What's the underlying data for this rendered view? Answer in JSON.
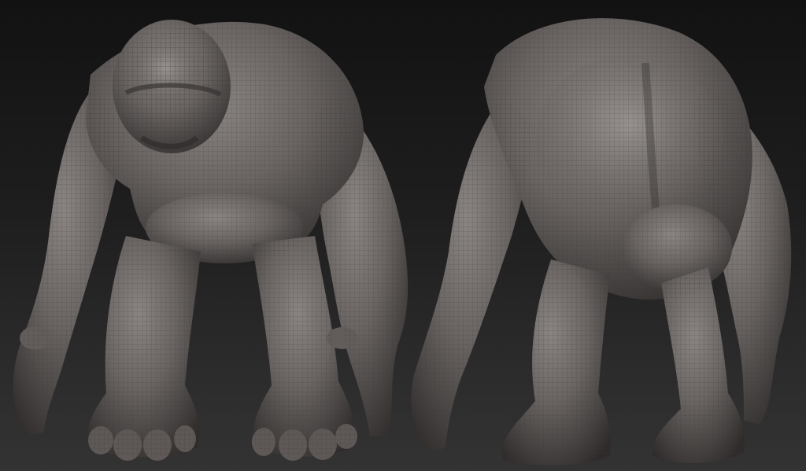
{
  "scene": {
    "background_top": "#121212",
    "background_bottom": "#333333",
    "model_color": "#6a6563",
    "model_shadow": "#2e2b2a",
    "wire_color": "#3c3938"
  },
  "views": [
    {
      "name": "front",
      "subject": "sculpted-creature-front"
    },
    {
      "name": "back",
      "subject": "sculpted-creature-back"
    }
  ]
}
